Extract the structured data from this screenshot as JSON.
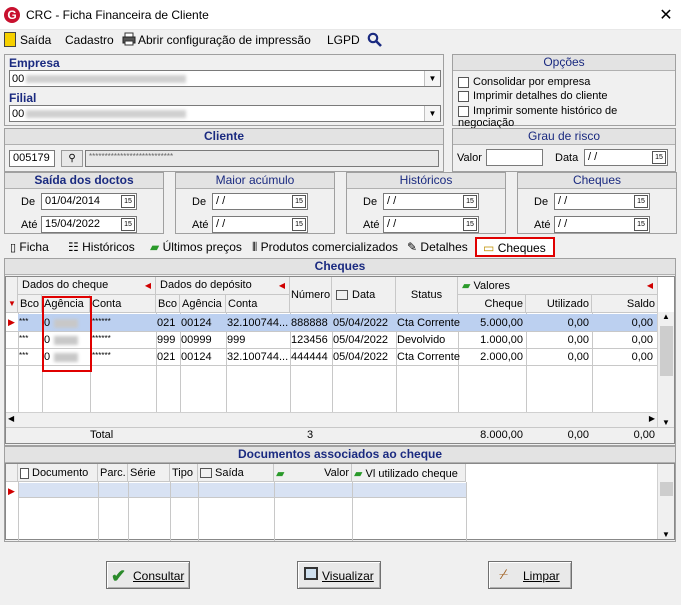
{
  "window": {
    "logo": "G",
    "title": "CRC - Ficha Financeira de Cliente",
    "close": "✕"
  },
  "menu": {
    "saida": "Saída",
    "cadastro": "Cadastro",
    "print_config": "Abrir configuração de impressão",
    "lgpd": "LGPD"
  },
  "empresa": {
    "label": "Empresa",
    "value": "00"
  },
  "filial": {
    "label": "Filial",
    "value": "00"
  },
  "opcoes": {
    "title": "Opções",
    "items": [
      "Consolidar por empresa",
      "Imprimir detalhes do cliente",
      "Imprimir somente histórico de negociação"
    ]
  },
  "cliente": {
    "title": "Cliente",
    "code": "005179",
    "name": "***************************"
  },
  "grau_risco": {
    "title": "Grau de risco",
    "valor_label": "Valor",
    "data_label": "Data",
    "data_value": " / /",
    "cal": "15"
  },
  "saida_doctos": {
    "title": "Saída dos doctos",
    "de_label": "De",
    "de": "01/04/2014",
    "ate_label": "Até",
    "ate": "15/04/2022"
  },
  "maior_acumulo": {
    "title": "Maior acúmulo",
    "de_label": "De",
    "de": " / /",
    "ate_label": "Até",
    "ate": " / /"
  },
  "historicos_box": {
    "title": "Históricos",
    "de_label": "De",
    "de": " / /",
    "ate_label": "Até",
    "ate": " / /"
  },
  "cheques_box": {
    "title": "Cheques",
    "de_label": "De",
    "de": " / /",
    "ate_label": "Até",
    "ate": " / /"
  },
  "tabs": [
    "Ficha",
    "Históricos",
    "Últimos preços",
    "Produtos comercializados",
    "Detalhes",
    "Cheques"
  ],
  "cheques": {
    "title": "Cheques",
    "groups": {
      "cheque": "Dados do cheque",
      "deposito": "Dados do depósito",
      "numero": "Número",
      "data": "Data",
      "status": "Status",
      "valores": "Valores"
    },
    "columns": {
      "bco": "Bco",
      "agencia": "Agência",
      "conta": "Conta",
      "bco2": "Bco",
      "agencia2": "Agência",
      "conta2": "Conta",
      "cheque": "Cheque",
      "utilizado": "Utilizado",
      "saldo": "Saldo"
    },
    "rows": [
      {
        "bco": "***",
        "agencia": "0",
        "conta": "******",
        "bco2": "021",
        "agencia2": "00124",
        "conta2": "32.100744...",
        "numero": "888888",
        "data": "05/04/2022",
        "status": "Cta Corrente",
        "cheque": "5.000,00",
        "utilizado": "0,00",
        "saldo": "0,00"
      },
      {
        "bco": "***",
        "agencia": "0",
        "conta": "******",
        "bco2": "999",
        "agencia2": "00999",
        "conta2": "999",
        "numero": "123456",
        "data": "05/04/2022",
        "status": "Devolvido",
        "cheque": "1.000,00",
        "utilizado": "0,00",
        "saldo": "0,00"
      },
      {
        "bco": "***",
        "agencia": "0",
        "conta": "******",
        "bco2": "021",
        "agencia2": "00124",
        "conta2": "32.100744...",
        "numero": "444444",
        "data": "05/04/2022",
        "status": "Cta Corrente",
        "cheque": "2.000,00",
        "utilizado": "0,00",
        "saldo": "0,00"
      }
    ],
    "total": {
      "label": "Total",
      "count": "3",
      "cheque": "8.000,00",
      "utilizado": "0,00",
      "saldo": "0,00"
    }
  },
  "documentos": {
    "title": "Documentos associados ao cheque",
    "columns": [
      "Documento",
      "Parc.",
      "Série",
      "Tipo",
      "Saída",
      "Valor",
      "Vl utilizado cheque"
    ]
  },
  "buttons": {
    "consultar": "Consultar",
    "visualizar": "Visualizar",
    "limpar": "Limpar"
  },
  "colors": {
    "accent_blue": "#1a2a80",
    "highlight_red": "#e00000",
    "selected_row": "#bcd0f0"
  }
}
